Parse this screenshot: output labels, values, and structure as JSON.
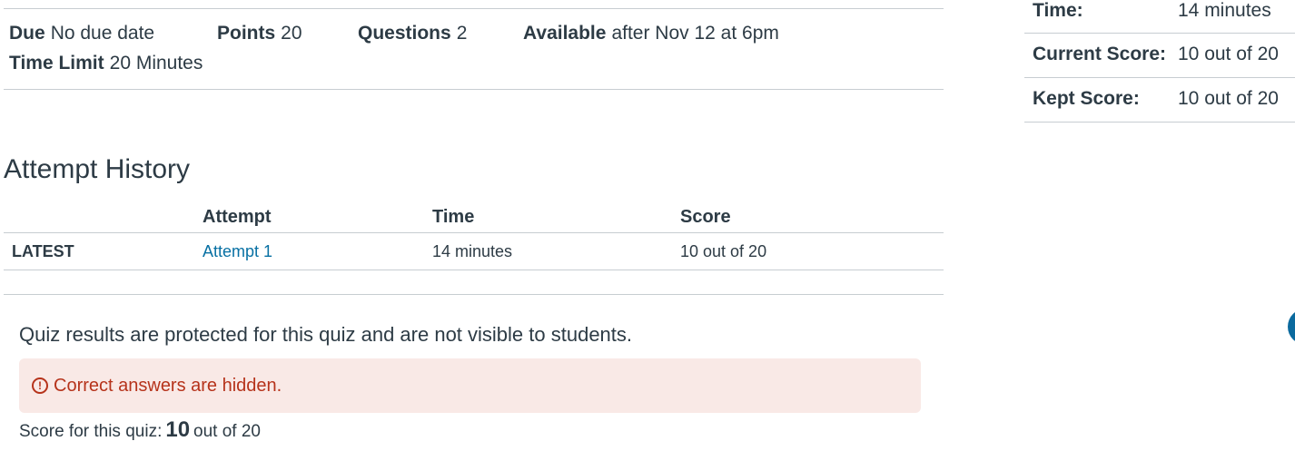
{
  "quiz_meta": {
    "due_label": "Due",
    "due_value": "No due date",
    "points_label": "Points",
    "points_value": "20",
    "questions_label": "Questions",
    "questions_value": "2",
    "available_label": "Available",
    "available_value": "after Nov 12 at 6pm",
    "time_limit_label": "Time Limit",
    "time_limit_value": "20 Minutes"
  },
  "attempt_history": {
    "title": "Attempt History",
    "headers": [
      "",
      "Attempt",
      "Time",
      "Score"
    ],
    "rows": [
      {
        "tag": "LATEST",
        "attempt": "Attempt 1",
        "time": "14 minutes",
        "score": "10 out of 20"
      }
    ]
  },
  "results": {
    "protected_text": "Quiz results are protected for this quiz and are not visible to students.",
    "alert_icon": "exclamation-circle-icon",
    "alert_text": "Correct answers are hidden.",
    "score_prefix": "Score for this quiz:",
    "score_value": "10",
    "score_suffix": "out of 20"
  },
  "sidebar": {
    "rows": [
      {
        "label": "Time:",
        "value": "14 minutes"
      },
      {
        "label": "Current Score:",
        "value": "10 out of 20"
      },
      {
        "label": "Kept Score:",
        "value": "10 out of 20"
      }
    ]
  },
  "colors": {
    "text": "#2d3b45",
    "link": "#0770a3",
    "alert_bg": "#f9e9e6",
    "alert_text": "#b6331b",
    "divider": "#c7cdd1"
  }
}
